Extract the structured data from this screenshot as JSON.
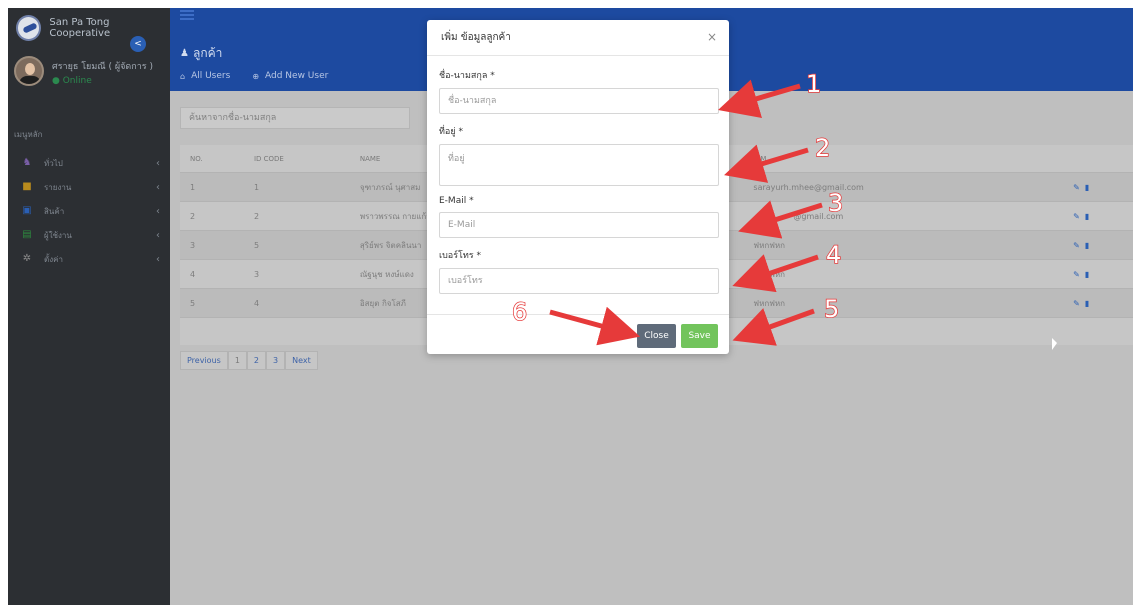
{
  "app": {
    "brand_name": "San Pa Tong Cooperative",
    "user_name": "ศรายุธ โยมณี ( ผู้จัดการ )",
    "user_status": "● Online"
  },
  "sidebar": {
    "section_label": "เมนูหลัก",
    "items": [
      {
        "label": "ทั่วไป",
        "icon": "users-icon",
        "color": "#7a5fa8"
      },
      {
        "label": "รายงาน",
        "icon": "folder-icon",
        "color": "#b98b1d"
      },
      {
        "label": "สินค้า",
        "icon": "box-icon",
        "color": "#2a5fb4"
      },
      {
        "label": "ผู้ใช้งาน",
        "icon": "user-card-icon",
        "color": "#2d8c3e"
      },
      {
        "label": "ตั้งค่า",
        "icon": "gear-icon",
        "color": "#8a8a8a"
      }
    ]
  },
  "header": {
    "title": "ลูกค้า",
    "tabs": [
      {
        "label": "All Users"
      },
      {
        "label": "Add New User"
      }
    ]
  },
  "search": {
    "placeholder": "ค้นหาจากชื่อ-นามสกุล"
  },
  "table": {
    "headers": {
      "no": "NO.",
      "id": "ID CODE",
      "name": "NAME",
      "email": "E-M"
    },
    "rows": [
      {
        "no": "1",
        "id": "1",
        "name": "จุฑาภรณ์ นุศาสม",
        "email": "sarayurh.mhee@gmail.com"
      },
      {
        "no": "2",
        "id": "2",
        "name": "พราวพรรณ กายแก้ว",
        "email": "@gmail.com"
      },
      {
        "no": "3",
        "id": "5",
        "name": "สุริย์พร จิตคลินนา",
        "email": "ฟหกฟหก"
      },
      {
        "no": "4",
        "id": "3",
        "name": "ณัฐนุช หงษ์แดง",
        "email": "ฟหกฟหก"
      },
      {
        "no": "5",
        "id": "4",
        "name": "อิสยุต กิจโสภี",
        "email": "ฟหกฟหก"
      }
    ]
  },
  "pagination": {
    "previous": "Previous",
    "pages": [
      "1",
      "2",
      "3"
    ],
    "next": "Next"
  },
  "modal": {
    "title": "เพิ่ม ข้อมูลลูกค้า",
    "close_symbol": "×",
    "fields": {
      "name": {
        "label": "ชื่อ-นามสกุล *",
        "placeholder": "ชื่อ-นามสกุล"
      },
      "address": {
        "label": "ที่อยู่ *",
        "placeholder": "ที่อยู่"
      },
      "email": {
        "label": "E-Mail *",
        "placeholder": "E-Mail"
      },
      "phone": {
        "label": "เบอร์โทร *",
        "placeholder": "เบอร์โทร"
      }
    },
    "close_label": "Close",
    "save_label": "Save"
  },
  "callouts": [
    "1",
    "2",
    "3",
    "4",
    "5",
    "6"
  ],
  "colors": {
    "header_blue": "#1d4aa0",
    "save_green": "#72c45c",
    "close_gray": "#5f6b7a",
    "arrow_red": "#e63a3a"
  }
}
